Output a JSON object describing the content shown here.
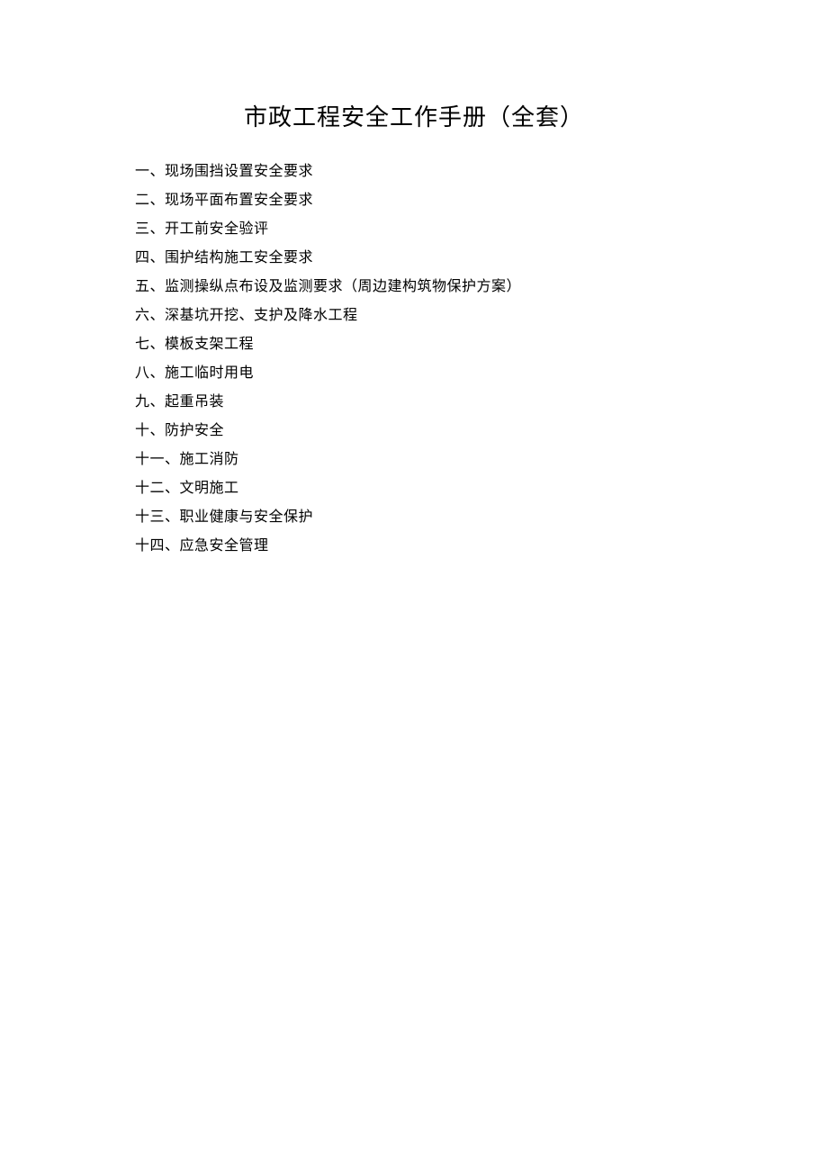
{
  "title": "市政工程安全工作手册（全套）",
  "toc": [
    "一、现场围挡设置安全要求",
    "二、现场平面布置安全要求",
    "三、开工前安全验评",
    "四、围护结构施工安全要求",
    "五、监测操纵点布设及监测要求（周边建构筑物保护方案）",
    "六、深基坑开挖、支护及降水工程",
    "七、模板支架工程",
    "八、施工临时用电",
    "九、起重吊装",
    "十、防护安全",
    "十一、施工消防",
    "十二、文明施工",
    "十三、职业健康与安全保护",
    "十四、应急安全管理"
  ]
}
